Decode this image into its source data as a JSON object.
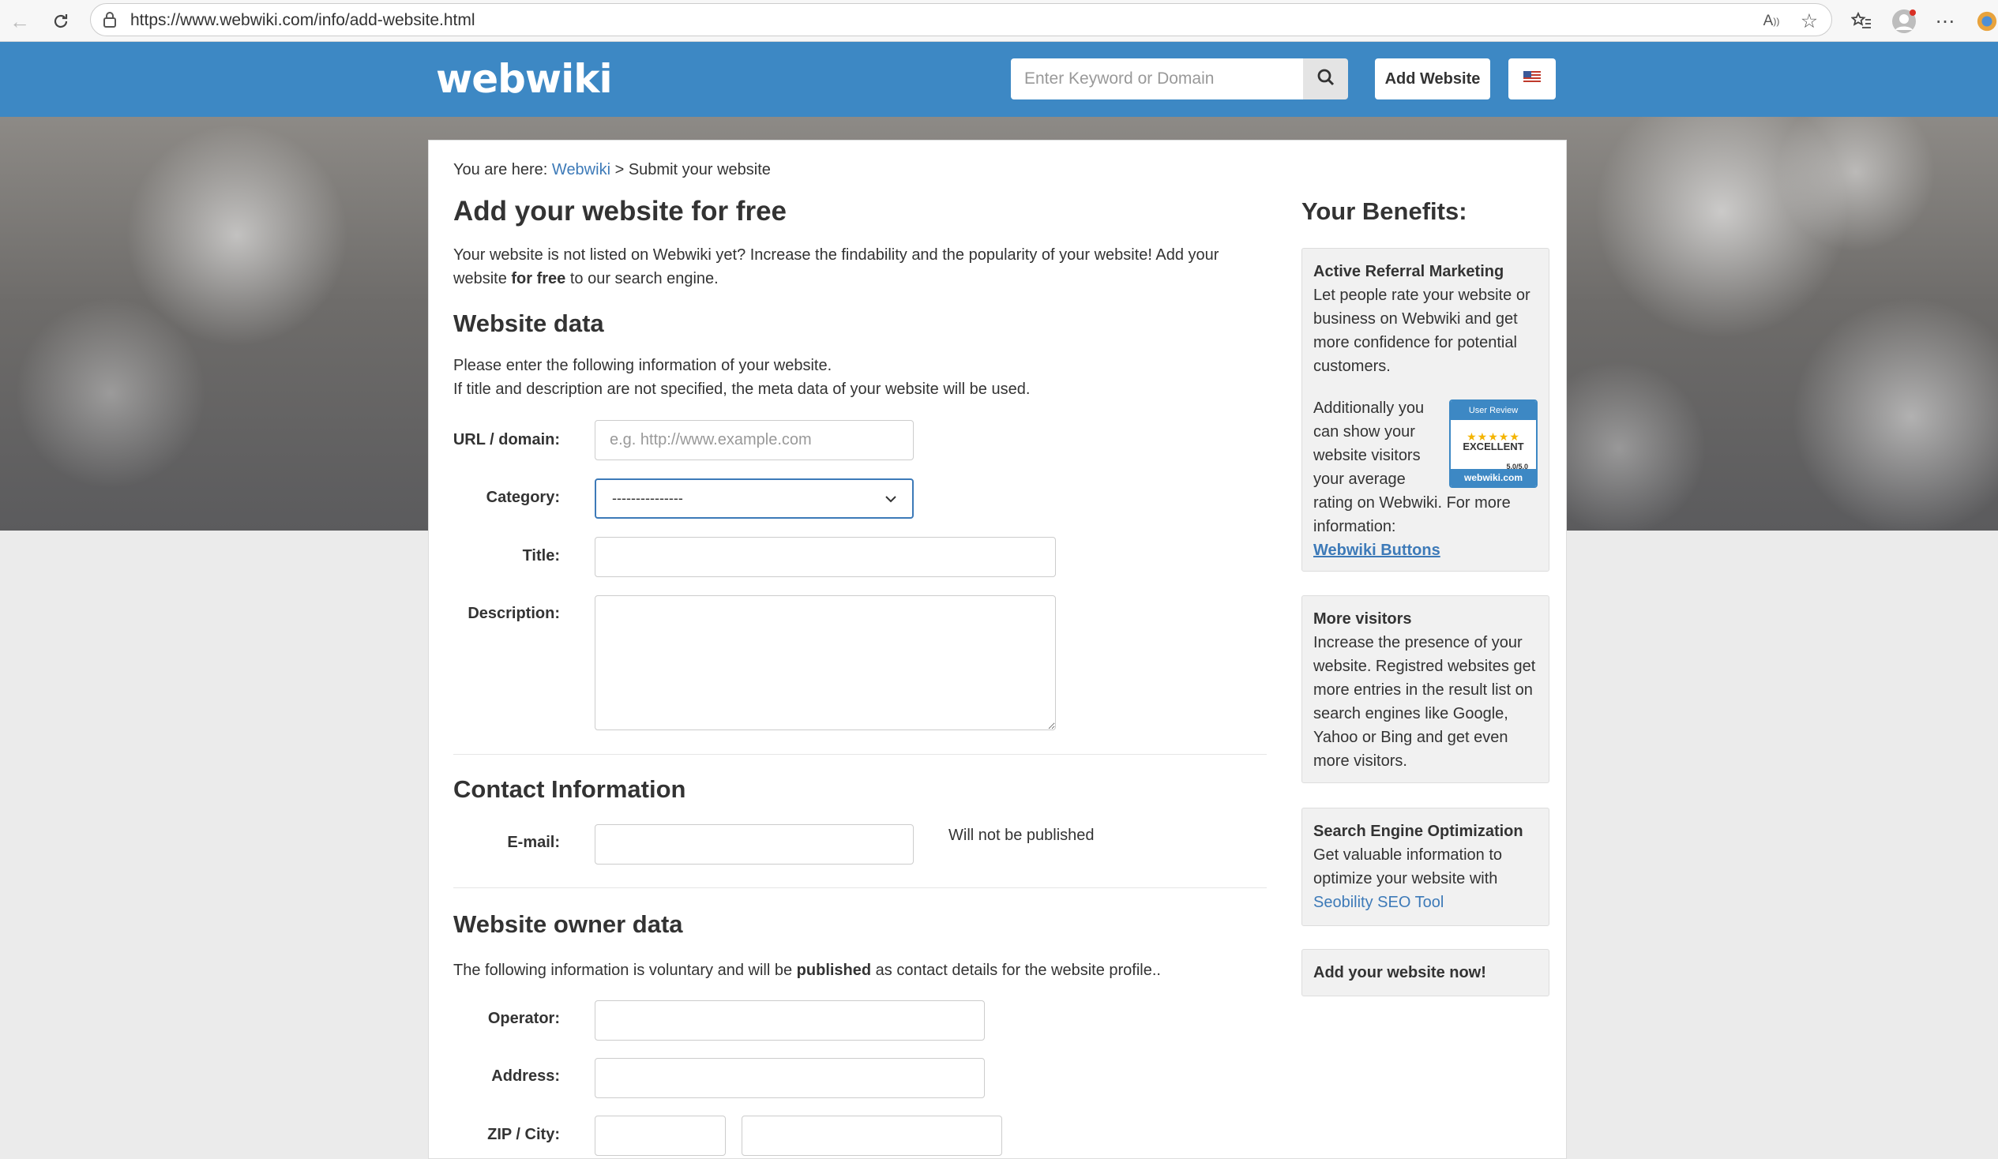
{
  "browser": {
    "url": "https://www.webwiki.com/info/add-website.html"
  },
  "header": {
    "logo": "webwiki",
    "search_placeholder": "Enter Keyword or Domain",
    "add_website_label": "Add Website"
  },
  "breadcrumb": {
    "prefix": "You are here:",
    "home_link": "Webwiki",
    "separator": ">",
    "current": "Submit your website"
  },
  "main": {
    "title": "Add your website for free",
    "intro_part1": "Your website is not listed on Webwiki yet? Increase the findability and the popularity of your website! Add your website ",
    "intro_bold": "for free",
    "intro_part2": " to our search engine.",
    "website_data": {
      "heading": "Website data",
      "line1": "Please enter the following information of your website.",
      "line2": "If title and description are not specified, the meta data of your website will be used.",
      "url_label": "URL / domain:",
      "url_placeholder": "e.g. http://www.example.com",
      "category_label": "Category:",
      "category_selected": "---------------",
      "title_label": "Title:",
      "description_label": "Description:"
    },
    "contact": {
      "heading": "Contact Information",
      "email_label": "E-mail:",
      "email_note": "Will not be published"
    },
    "owner": {
      "heading": "Website owner data",
      "text_part1": "The following information is voluntary and will be ",
      "text_bold": "published",
      "text_part2": " as contact details for the website profile..",
      "operator_label": "Operator:",
      "address_label": "Address:",
      "zip_city_label": "ZIP / City:"
    }
  },
  "sidebar": {
    "title": "Your Benefits:",
    "referral": {
      "heading": "Active Referral Marketing",
      "text": "Let people rate your website or business on Webwiki and get more confidence for potential customers.",
      "text2": "Additionally you can show your website visitors your average rating on Webwiki. For more information:",
      "link": "Webwiki Buttons",
      "badge_top": "User Review",
      "badge_stars": "★★★★★",
      "badge_rating": "EXCELLENT",
      "badge_score": "5.0/5.0",
      "badge_bottom": "webwiki.com"
    },
    "visitors": {
      "heading": "More visitors",
      "text": "Increase the presence of your website. Registred websites get more entries in the result list on search engines like Google, Yahoo or Bing and get even more visitors."
    },
    "seo": {
      "heading": "Search Engine Optimization",
      "text": "Get valuable information to optimize your website with",
      "link": "Seobility SEO Tool"
    },
    "cta": "Add your website now!"
  },
  "colors": {
    "header_blue": "#3d88c4",
    "link_blue": "#3d7ab8",
    "focus_blue": "#3d7ab8"
  }
}
